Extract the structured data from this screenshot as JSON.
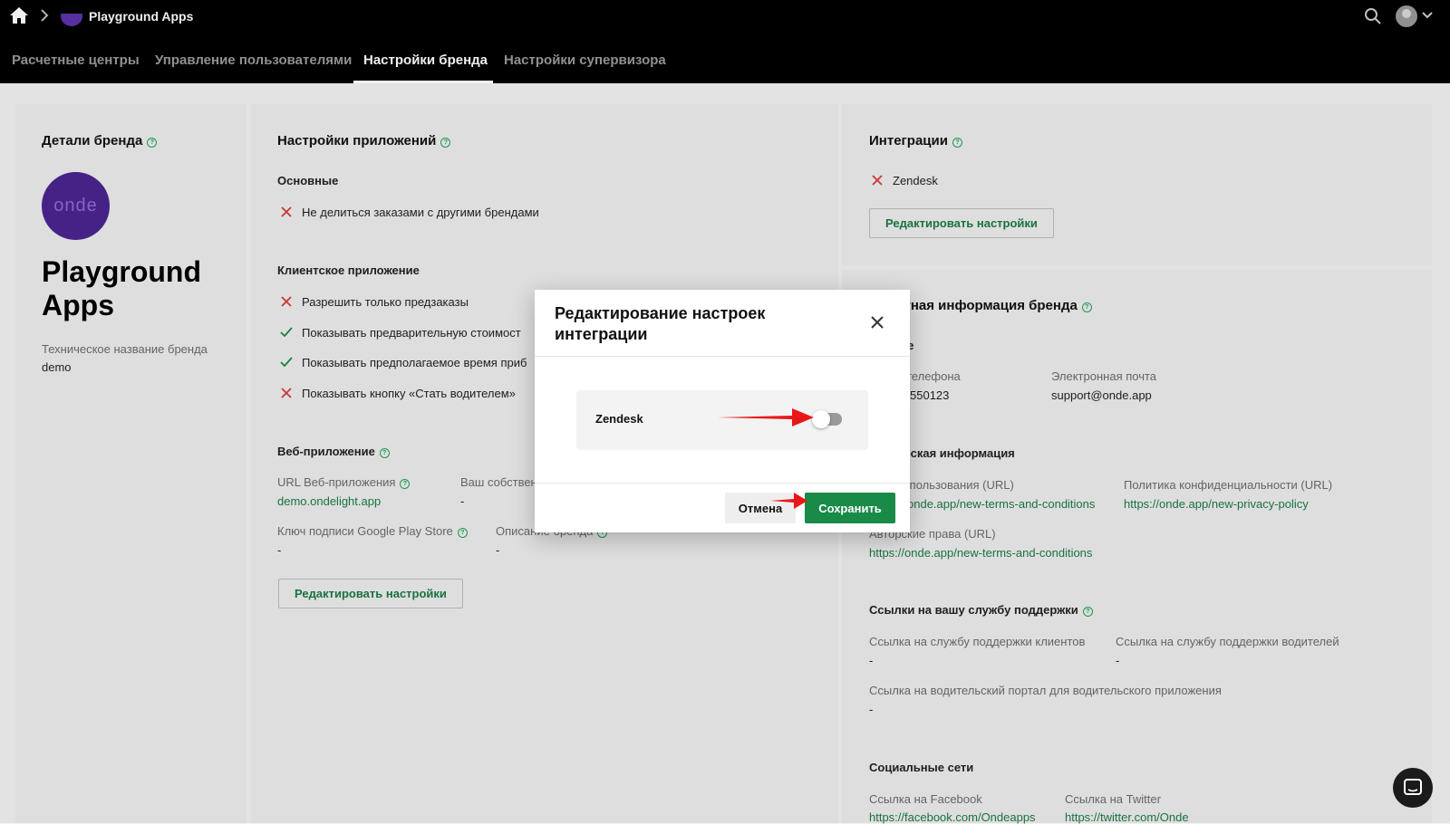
{
  "header": {
    "app_name": "Playground Apps",
    "tabs": [
      {
        "label": "Расчетные центры"
      },
      {
        "label": "Управление пользователями"
      },
      {
        "label": "Настройки бренда",
        "active": true
      },
      {
        "label": "Настройки супервизора"
      }
    ]
  },
  "brand_details": {
    "title": "Детали бренда",
    "logo_text": "onde",
    "brand_name": "Playground Apps",
    "tech_name_label": "Техническое название бренда",
    "tech_name_value": "demo"
  },
  "app_settings": {
    "title": "Настройки приложений",
    "basic_title": "Основные",
    "basic_items": [
      {
        "label": "Не делиться заказами с другими брендами",
        "enabled": false
      }
    ],
    "client_title": "Клиентское приложение",
    "client_items": [
      {
        "label": "Разрешить только предзаказы",
        "enabled": false
      },
      {
        "label": "Показывать предварительную стоимост",
        "enabled": true
      },
      {
        "label": "Показывать предполагаемое время приб",
        "enabled": true
      },
      {
        "label": "Показывать кнопку «Стать водителем»",
        "enabled": false
      }
    ],
    "web_title": "Веб-приложение",
    "web_url_label": "URL Веб-приложения",
    "web_url_value": "demo.ondelight.app",
    "own_label": "Ваш собствен",
    "own_value": "-",
    "gplay_label": "Ключ подписи Google Play Store",
    "gplay_value": "-",
    "desc_label": "Описание бренда",
    "desc_value": "-",
    "edit_button": "Редактировать настройки"
  },
  "integrations": {
    "title": "Интеграции",
    "items": [
      {
        "label": "Zendesk",
        "enabled": false
      }
    ],
    "edit_button": "Редактировать настройки"
  },
  "contact_info": {
    "title": "ктная информация бренда",
    "main_title": "ые",
    "phone_label": "телефона",
    "phone_value": "550123",
    "email_label": "Электронная почта",
    "email_value": "support@onde.app",
    "legal_title": "ческая информация",
    "terms_label": "я пользования (URL)",
    "terms_value": "onde.app/new-terms-and-conditions",
    "privacy_label": "Политика конфиденциальности (URL)",
    "privacy_value": "https://onde.app/new-privacy-policy",
    "copyright_label": "Авторские права (URL)",
    "copyright_value": "https://onde.app/new-terms-and-conditions",
    "support_title": "Ссылки на вашу службу поддержки",
    "client_support_label": "Ссылка на службу поддержки клиентов",
    "client_support_value": "-",
    "driver_support_label": "Ссылка на службу поддержки водителей",
    "driver_support_value": "-",
    "driver_portal_label": "Ссылка на водительский портал для водительского приложения",
    "driver_portal_value": "-",
    "social_title": "Социальные сети",
    "facebook_label": "Ссылка на Facebook",
    "facebook_value": "https://facebook.com/Ondeapps",
    "twitter_label": "Ссылка на Twitter",
    "twitter_value": "https://twitter.com/Onde"
  },
  "modal": {
    "title": "Редактирование настроек интеграции",
    "row_label": "Zendesk",
    "toggle_on": false,
    "cancel_label": "Отмена",
    "save_label": "Сохранить"
  },
  "colors": {
    "accent_green": "#198a48",
    "link_green": "#1a7a45",
    "error_red": "#d63b3b",
    "annotation_arrow": "#e81818"
  }
}
